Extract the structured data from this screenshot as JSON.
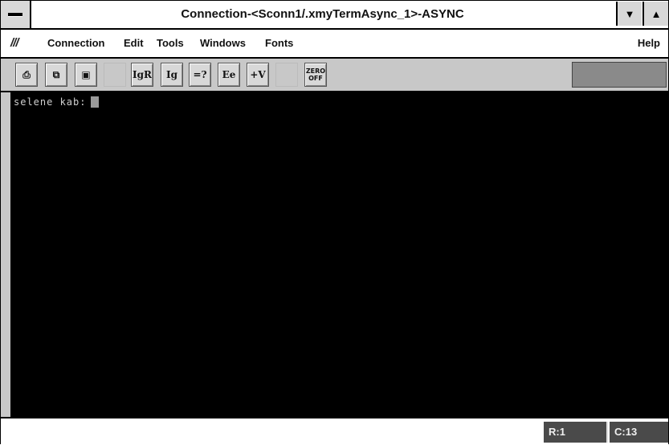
{
  "window": {
    "title": "Connection-<Sconn1/.xmyTermAsync_1>-ASYNC",
    "minimize_glyph": "▼",
    "maximize_glyph": "▲"
  },
  "menubar": {
    "logo": "///",
    "items": [
      "Connection",
      "Edit",
      "Tools",
      "Windows",
      "Fonts"
    ],
    "help": "Help"
  },
  "toolbar": {
    "buttons": [
      {
        "icon": "print-icon",
        "glyph": "⎙"
      },
      {
        "icon": "copy-icon",
        "glyph": "⧉"
      },
      {
        "icon": "paste-icon",
        "glyph": "▣"
      },
      {
        "label": "IgR"
      },
      {
        "label": "Ig"
      },
      {
        "label": "=?"
      },
      {
        "label": "Ee"
      },
      {
        "label": "+V"
      },
      {
        "label_top": "ZERO",
        "label_bottom": "OFF"
      }
    ],
    "status_box": ""
  },
  "terminal": {
    "prompt": "selene kab:"
  },
  "statusbar": {
    "row": "R:1",
    "col": "C:13"
  },
  "colors": {
    "terminal_bg": "#000000",
    "terminal_fg": "#d0d0d0",
    "status_cell_bg": "#4a4a4a"
  }
}
